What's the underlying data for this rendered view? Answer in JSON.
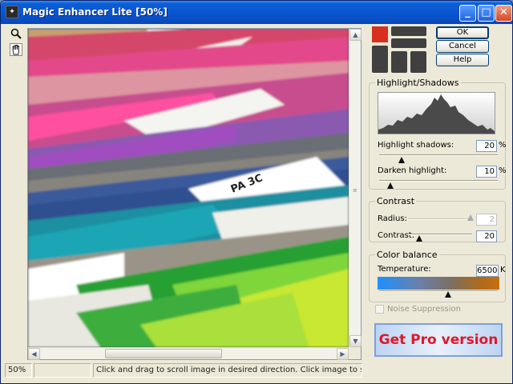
{
  "window": {
    "title": "Magic Enhancer Lite [50%]",
    "app_icon": "magic-enhancer-app-icon",
    "buttons": {
      "minimize_icon": "minimize-icon",
      "maximize_icon": "maximize-icon",
      "close_icon": "close-icon"
    }
  },
  "tools": {
    "zoom_icon": "magnifier-icon",
    "pan_icon": "hand-icon"
  },
  "viewer": {
    "image": "photo of colored stacked paper sheets (pink, purple, blue, teal, green, yellow, white)"
  },
  "statusbar": {
    "zoom": "50%",
    "message": "Click and drag to scroll image in desired direction. Click image to see original."
  },
  "dialog_buttons": {
    "ok": "OK",
    "cancel": "Cancel",
    "help": "Help"
  },
  "highlight_shadows": {
    "title": "Highlight/Shadows",
    "highlight_shadows_label": "Highlight shadows:",
    "highlight_shadows_value": "20",
    "darken_highlight_label": "Darken highlight:",
    "darken_highlight_value": "10",
    "percent": "%"
  },
  "contrast": {
    "title": "Contrast",
    "radius_label": "Radius:",
    "radius_value": "2",
    "contrast_label": "Contrast:",
    "contrast_value": "20"
  },
  "color_balance": {
    "title": "Color balance",
    "temperature_label": "Temperature:",
    "temperature_value": "6500",
    "unit": "K"
  },
  "noise_suppression": {
    "label": "Noise Suppression",
    "checked": false,
    "enabled": false
  },
  "promo": {
    "label": "Get Pro version"
  },
  "colors": {
    "titlebar": "#0a55d0",
    "pro_text": "#e0172b",
    "temp_cold": "#1e90ff",
    "temp_warm": "#c76f10"
  }
}
